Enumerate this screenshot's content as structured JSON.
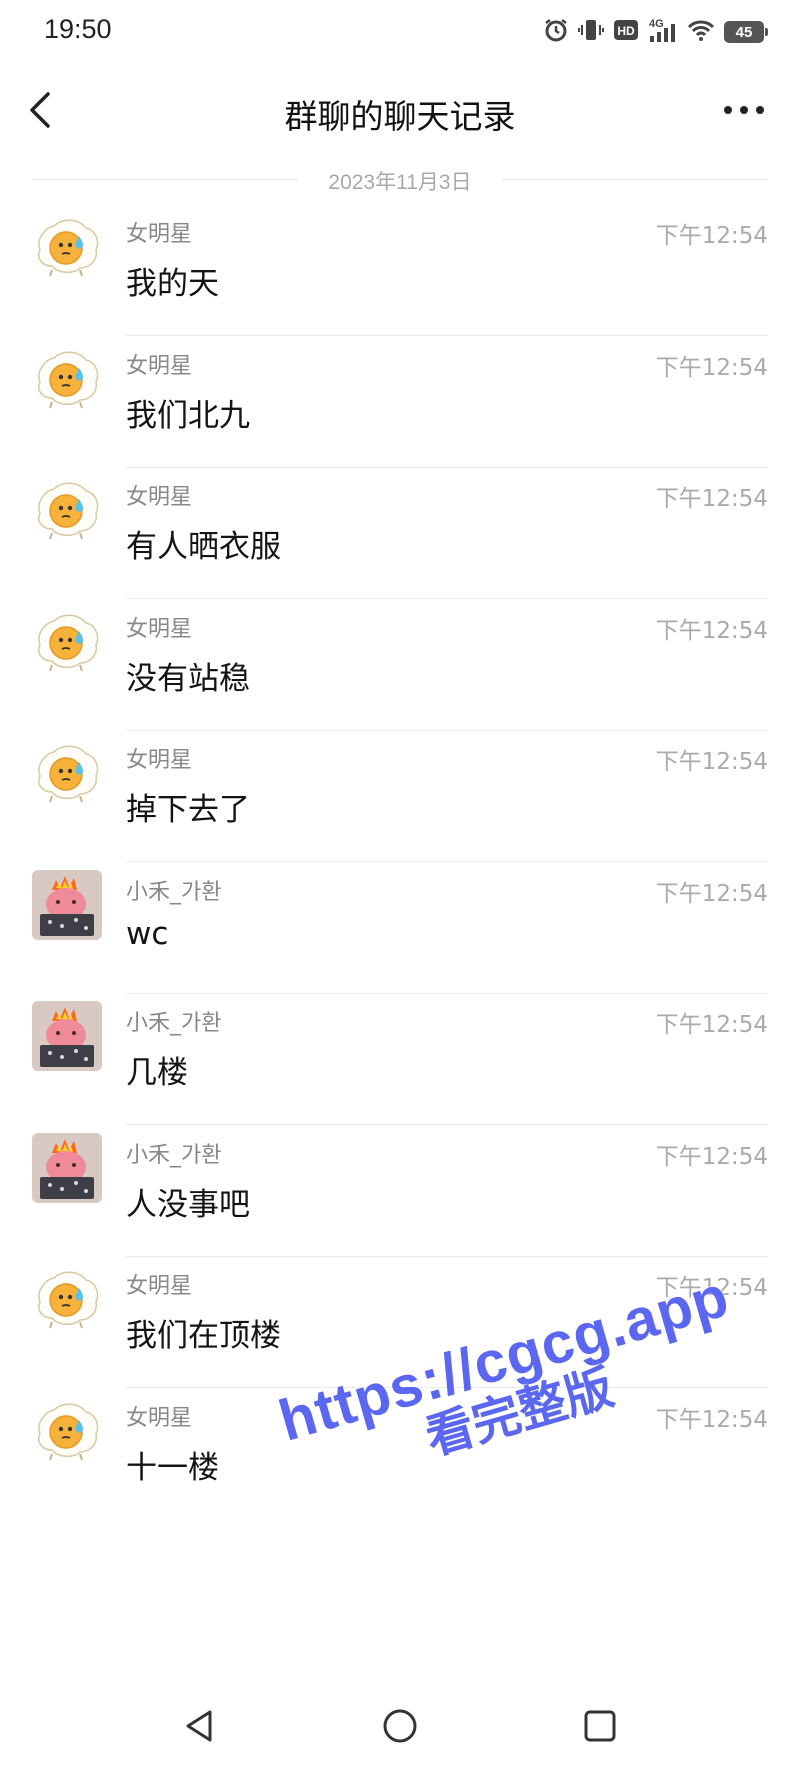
{
  "status_bar": {
    "time": "19:50",
    "battery": "45",
    "icons": [
      "alarm-icon",
      "vibrate-icon",
      "hd-icon",
      "signal-4g-icon",
      "wifi-icon",
      "battery-icon"
    ],
    "signal_label": "4G",
    "hd_label": "HD"
  },
  "header": {
    "title": "群聊的聊天记录",
    "back_icon": "chevron-left-icon",
    "more_icon": "more-dots-icon"
  },
  "date_divider": "2023年11月3日",
  "messages": [
    {
      "sender": "女明星",
      "time": "下午12:54",
      "text": "我的天",
      "avatar": "fried-egg-avatar"
    },
    {
      "sender": "女明星",
      "time": "下午12:54",
      "text": "我们北九",
      "avatar": "fried-egg-avatar"
    },
    {
      "sender": "女明星",
      "time": "下午12:54",
      "text": "有人晒衣服",
      "avatar": "fried-egg-avatar"
    },
    {
      "sender": "女明星",
      "time": "下午12:54",
      "text": "没有站稳",
      "avatar": "fried-egg-avatar"
    },
    {
      "sender": "女明星",
      "time": "下午12:54",
      "text": "掉下去了",
      "avatar": "fried-egg-avatar"
    },
    {
      "sender": "小禾_가환",
      "time": "下午12:54",
      "text": "wc",
      "avatar": "pink-creature-avatar"
    },
    {
      "sender": "小禾_가환",
      "time": "下午12:54",
      "text": "几楼",
      "avatar": "pink-creature-avatar"
    },
    {
      "sender": "小禾_가환",
      "time": "下午12:54",
      "text": "人没事吧",
      "avatar": "pink-creature-avatar"
    },
    {
      "sender": "女明星",
      "time": "下午12:54",
      "text": "我们在顶楼",
      "avatar": "fried-egg-avatar"
    },
    {
      "sender": "女明星",
      "time": "下午12:54",
      "text": "十一楼",
      "avatar": "fried-egg-avatar"
    }
  ],
  "watermark": {
    "url": "https://cgcg.app",
    "cta": "看完整版",
    "color": "#5b67f0"
  },
  "bottom_nav": {
    "buttons": [
      "back-triangle-icon",
      "home-circle-icon",
      "recents-square-icon"
    ]
  }
}
